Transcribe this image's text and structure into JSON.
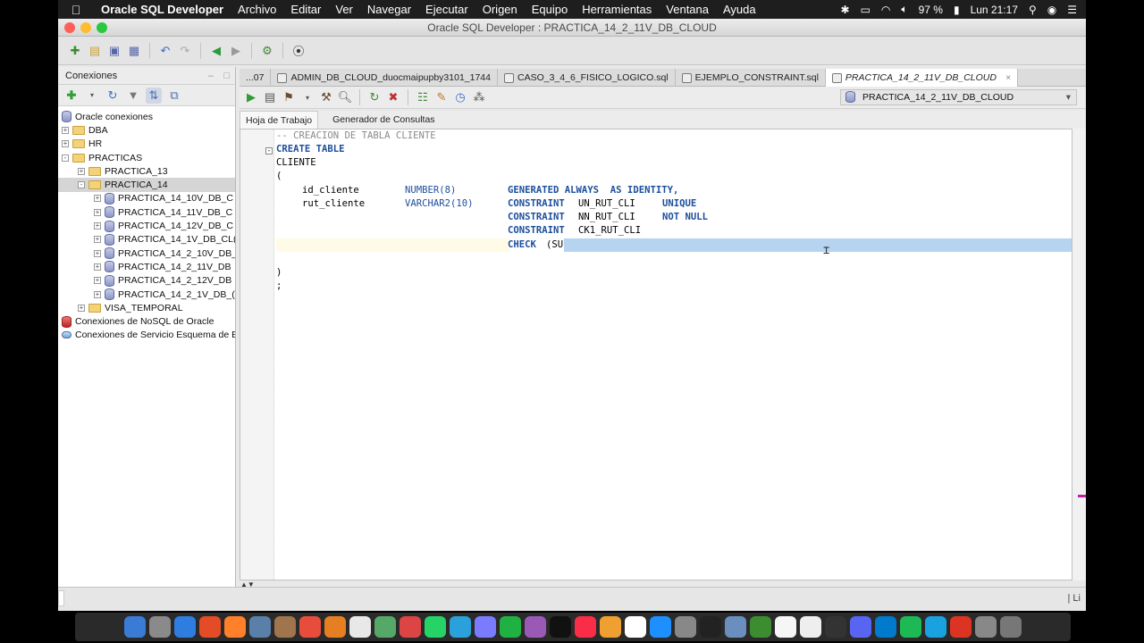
{
  "menubar": {
    "app": "Oracle SQL Developer",
    "items": [
      "Archivo",
      "Editar",
      "Ver",
      "Navegar",
      "Ejecutar",
      "Origen",
      "Equipo",
      "Herramientas",
      "Ventana",
      "Ayuda"
    ],
    "battery": "97 %",
    "clock": "Lun 21:17"
  },
  "window": {
    "title": "Oracle SQL Developer : PRACTICA_14_2_11V_DB_CLOUD"
  },
  "left_panel": {
    "title": "Conexiones",
    "tree": [
      {
        "label": "Oracle conexiones",
        "level": 0,
        "kind": "db"
      },
      {
        "label": "DBA",
        "level": 1,
        "kind": "folder",
        "expander": "+"
      },
      {
        "label": "HR",
        "level": 1,
        "kind": "folder",
        "expander": "+"
      },
      {
        "label": "PRACTICAS",
        "level": 1,
        "kind": "folder",
        "expander": "-"
      },
      {
        "label": "PRACTICA_13",
        "level": 2,
        "kind": "folder",
        "expander": "+"
      },
      {
        "label": "PRACTICA_14",
        "level": 2,
        "kind": "folder",
        "expander": "-",
        "selected": true
      },
      {
        "label": "PRACTICA_14_10V_DB_C",
        "level": 3,
        "kind": "db",
        "expander": "+"
      },
      {
        "label": "PRACTICA_14_11V_DB_C",
        "level": 3,
        "kind": "db",
        "expander": "+"
      },
      {
        "label": "PRACTICA_14_12V_DB_C",
        "level": 3,
        "kind": "db",
        "expander": "+"
      },
      {
        "label": "PRACTICA_14_1V_DB_CL(",
        "level": 3,
        "kind": "db",
        "expander": "+"
      },
      {
        "label": "PRACTICA_14_2_10V_DB_",
        "level": 3,
        "kind": "db",
        "expander": "+"
      },
      {
        "label": "PRACTICA_14_2_11V_DB",
        "level": 3,
        "kind": "db",
        "expander": "+"
      },
      {
        "label": "PRACTICA_14_2_12V_DB",
        "level": 3,
        "kind": "db",
        "expander": "+"
      },
      {
        "label": "PRACTICA_14_2_1V_DB_(",
        "level": 3,
        "kind": "db",
        "expander": "+"
      },
      {
        "label": "VISA_TEMPORAL",
        "level": 2,
        "kind": "folder",
        "expander": "+"
      },
      {
        "label": "Conexiones de NoSQL de Oracle",
        "level": 0,
        "kind": "nosql"
      },
      {
        "label": "Conexiones de Servicio Esquema de E",
        "level": 0,
        "kind": "cloud"
      }
    ]
  },
  "tabs": [
    {
      "label": "...07"
    },
    {
      "label": "ADMIN_DB_CLOUD_duocmaipupby3101_1744"
    },
    {
      "label": "CASO_3_4_6_FISICO_LOGICO.sql"
    },
    {
      "label": "EJEMPLO_CONSTRAINT.sql"
    },
    {
      "label": "PRACTICA_14_2_11V_DB_CLOUD",
      "active": true
    }
  ],
  "connection_select": "PRACTICA_14_2_11V_DB_CLOUD",
  "subtabs": [
    "Hoja de Trabajo",
    "Generador de Consultas"
  ],
  "code": {
    "comment": "-- CREACION DE TABLA CLIENTE",
    "l_create": "CREATE TABLE",
    "l_name": "CLIENTE",
    "l_open": "(",
    "c1_name": "id_cliente",
    "c1_type": "NUMBER(8)",
    "c1_gen": "GENERATED ALWAYS  AS IDENTITY,",
    "c2_name": "rut_cliente",
    "c2_type": "VARCHAR2(10)",
    "constraint": "CONSTRAINT",
    "un_name": "UN_RUT_CLI",
    "unique": "UNIQUE",
    "nn_name": "NN_RUT_CLI",
    "notnull": "NOT NULL",
    "ck_name": "CK1_RUT_CLI",
    "check": "CHECK",
    "check_arg": "(SU",
    "l_close": ")",
    "l_semi": ";"
  },
  "status": {
    "right": "| Li"
  },
  "colors": {
    "selection": "#b6d4f0",
    "keyword": "#1c4e9c",
    "current_line": "#fffbe6"
  }
}
